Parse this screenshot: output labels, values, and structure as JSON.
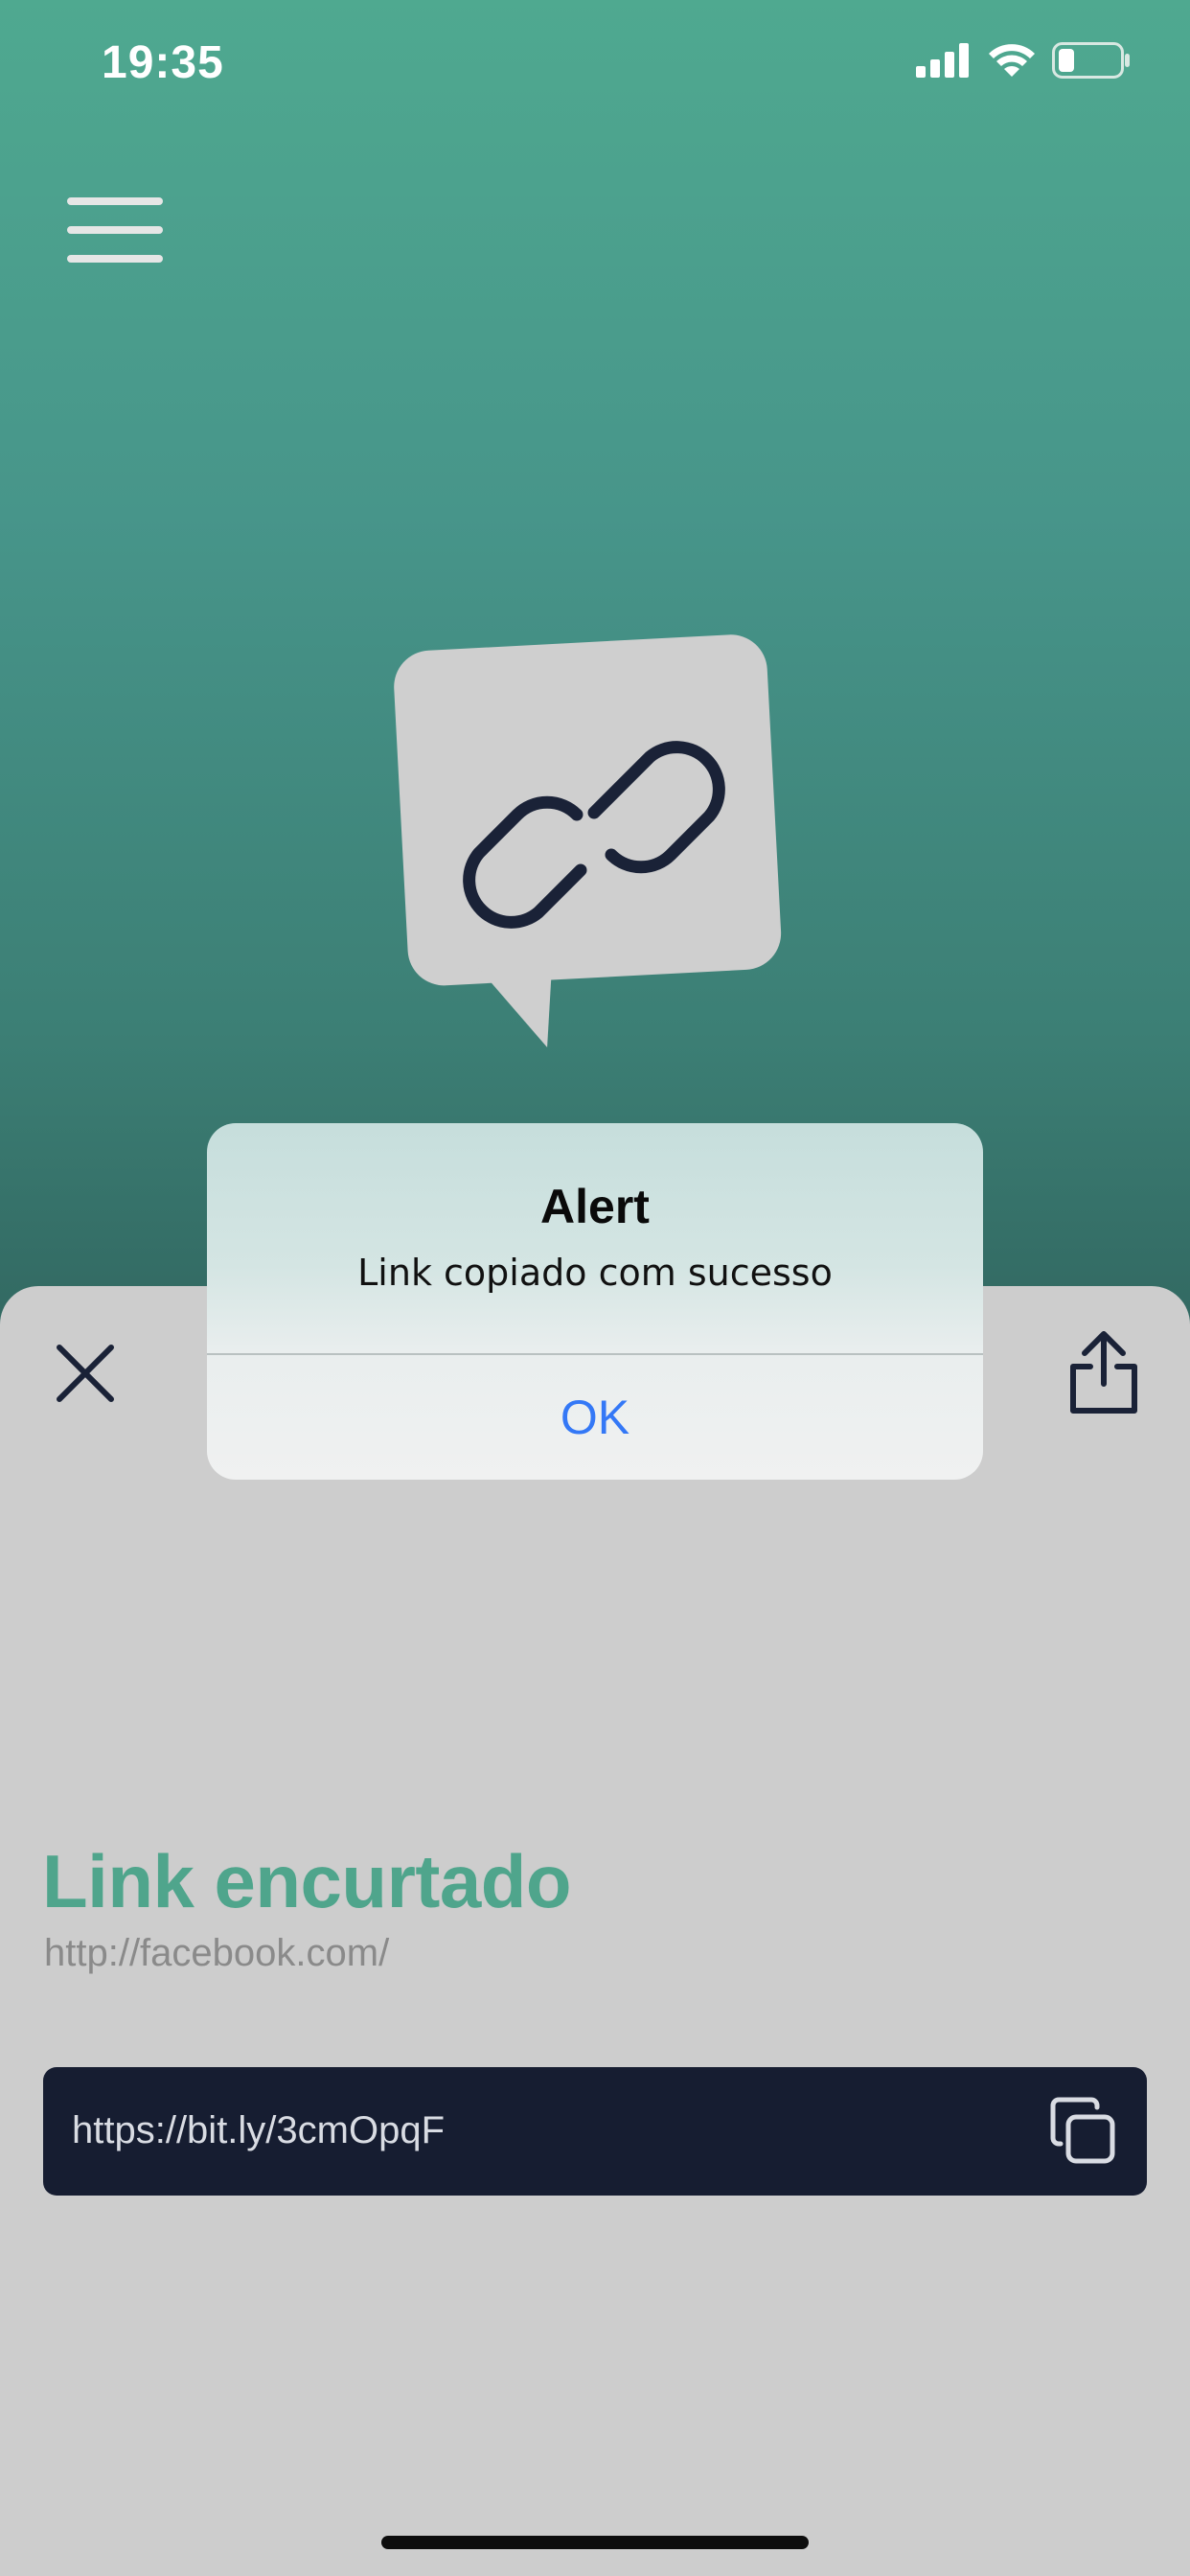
{
  "status_bar": {
    "time": "19:35",
    "icons": [
      "cellular-signal-icon",
      "wifi-icon",
      "battery-icon"
    ]
  },
  "header": {
    "menu_icon": "hamburger-menu-icon"
  },
  "hero": {
    "icon": "link-chat-bubble-icon"
  },
  "sheet": {
    "close_icon": "close-icon",
    "share_icon": "share-icon",
    "title": "Link encurtado",
    "original_url": "http://facebook.com/",
    "short_url": "https://bit.ly/3cmOpqF",
    "copy_icon": "copy-icon"
  },
  "alert": {
    "title": "Alert",
    "message": "Link copiado com sucesso",
    "ok_label": "OK"
  },
  "colors": {
    "gradient_top": "#4fa990",
    "gradient_bottom": "#2a5853",
    "sheet_background": "#cdcdcd",
    "title_accent": "#4fa58c",
    "url_box": "#161d31",
    "ios_blue": "#3478f6"
  }
}
